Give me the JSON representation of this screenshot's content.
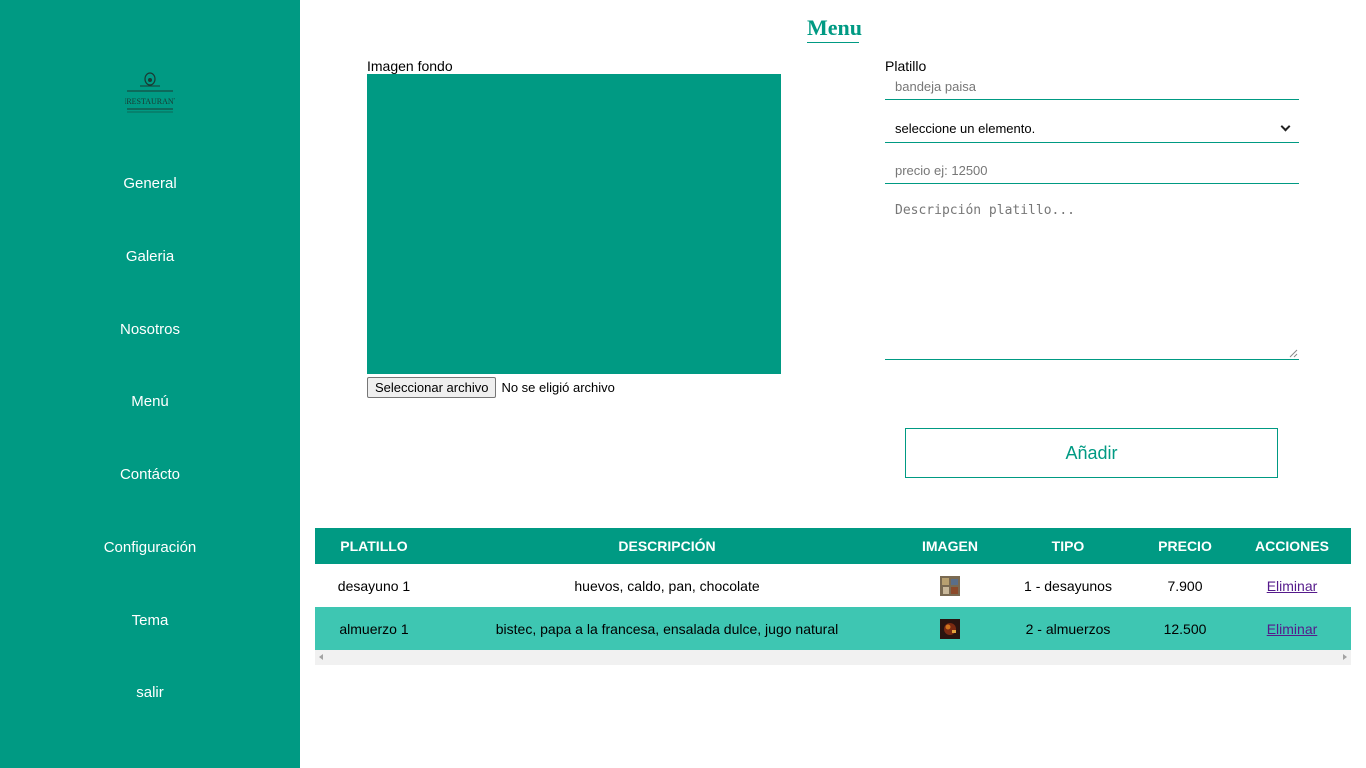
{
  "sidebar": {
    "logo_text": "MIRESTAURANTE",
    "items": [
      {
        "label": "General"
      },
      {
        "label": "Galeria"
      },
      {
        "label": "Nosotros"
      },
      {
        "label": "Menú"
      },
      {
        "label": "Contácto"
      },
      {
        "label": "Configuración"
      },
      {
        "label": "Tema"
      },
      {
        "label": "salir"
      }
    ]
  },
  "page": {
    "title": "Menu"
  },
  "image_upload": {
    "label": "Imagen fondo",
    "button_label": "Seleccionar archivo",
    "status": "No se eligió archivo"
  },
  "form": {
    "platillo_label": "Platillo",
    "platillo_placeholder": "bandeja paisa",
    "tipo_selected": "seleccione un elemento.",
    "precio_placeholder": "precio ej: 12500",
    "descripcion_placeholder": "Descripción platillo...",
    "add_button": "Añadir"
  },
  "table": {
    "headers": [
      "PLATILLO",
      "DESCRIPCIÓN",
      "IMAGEN",
      "TIPO",
      "PRECIO",
      "ACCIONES"
    ],
    "rows": [
      {
        "platillo": "desayuno 1",
        "descripcion": "huevos, caldo, pan, chocolate",
        "tipo": "1 - desayunos",
        "precio": "7.900",
        "accion": "Eliminar"
      },
      {
        "platillo": "almuerzo 1",
        "descripcion": "bistec, papa a la francesa, ensalada dulce, jugo natural",
        "tipo": "2 - almuerzos",
        "precio": "12.500",
        "accion": "Eliminar"
      }
    ]
  },
  "colors": {
    "accent": "#009a83",
    "row_highlight": "#3ec6b2",
    "link": "#551a8b"
  },
  "icons": [
    "logo-icon",
    "chevron-down-icon",
    "resize-grip-icon",
    "scroll-left-icon",
    "scroll-right-icon"
  ]
}
